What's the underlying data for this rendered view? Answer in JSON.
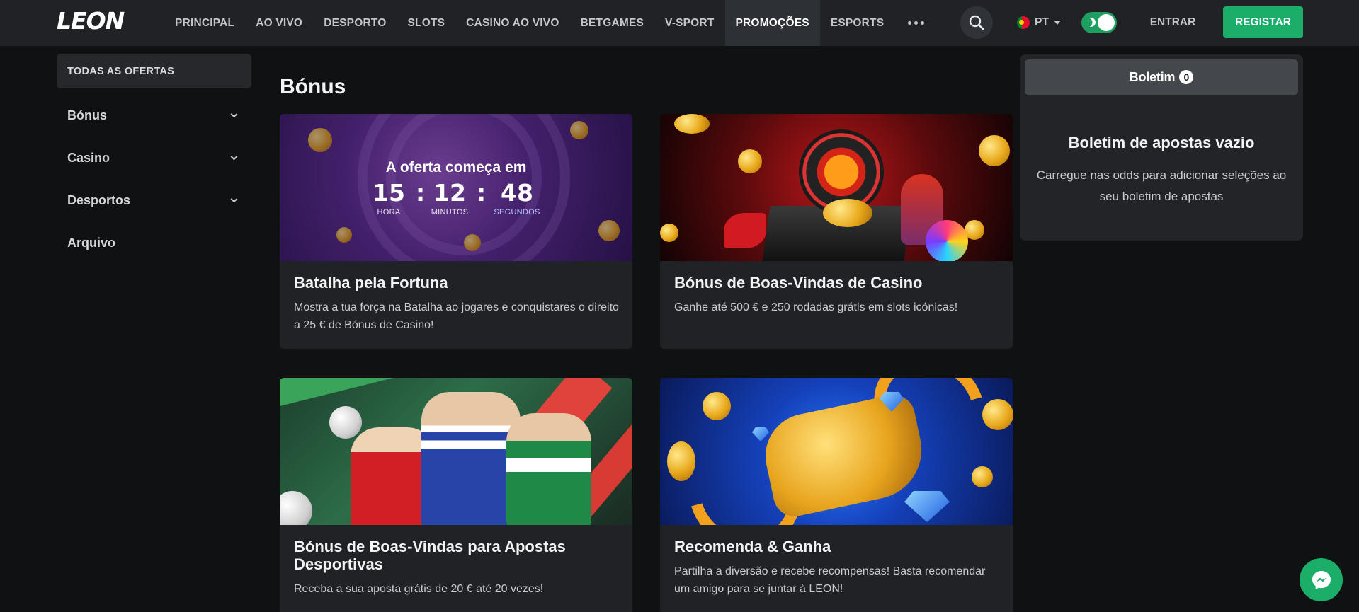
{
  "header": {
    "logo": "LEON",
    "nav": [
      {
        "label": "PRINCIPAL"
      },
      {
        "label": "AO VIVO"
      },
      {
        "label": "DESPORTO"
      },
      {
        "label": "SLOTS"
      },
      {
        "label": "CASINO AO VIVO"
      },
      {
        "label": "BETGAMES"
      },
      {
        "label": "V-SPORT"
      },
      {
        "label": "PROMOÇÕES",
        "active": true
      },
      {
        "label": "ESPORTS"
      }
    ],
    "language": "PT",
    "login_label": "ENTRAR",
    "register_label": "REGISTAR"
  },
  "sidebar": {
    "all_offers": "TODAS AS OFERTAS",
    "items": [
      {
        "label": "Bónus",
        "expandable": true
      },
      {
        "label": "Casino",
        "expandable": true
      },
      {
        "label": "Desportos",
        "expandable": true
      },
      {
        "label": "Arquivo",
        "expandable": false
      }
    ]
  },
  "main": {
    "title": "Bónus",
    "cards": [
      {
        "title": "Batalha pela Fortuna",
        "description": "Mostra a tua força na Batalha ao jogares e conquistares o direito a 25 € de Bónus de Casino!",
        "timer": {
          "label": "A oferta começa em",
          "hours": "15",
          "minutes": "12",
          "seconds": "48",
          "hours_label": "HORA",
          "minutes_label": "MINUTOS",
          "seconds_label": "SEGUNDOS"
        }
      },
      {
        "title": "Bónus de Boas-Vindas de Casino",
        "description": "Ganhe até 500 € e 250 rodadas grátis em slots icónicas!"
      },
      {
        "title": "Bónus de Boas-Vindas para Apostas Desportivas",
        "description": "Receba a sua aposta grátis de 20 € até 20 vezes!"
      },
      {
        "title": "Recomenda & Ganha",
        "description": "Partilha a diversão e recebe recompensas! Basta recomendar um amigo para se juntar à LEON!"
      }
    ]
  },
  "betslip": {
    "tab_label": "Boletim",
    "count": "0",
    "empty_title": "Boletim de apostas vazio",
    "empty_description": "Carregue nas odds para adicionar seleções ao seu boletim de apostas"
  },
  "colors": {
    "accent": "#1bae68",
    "header_bg": "#202225",
    "page_bg": "#101113",
    "card_bg": "#202226"
  },
  "icons": {
    "search": "search-icon",
    "more": "more-dots-icon",
    "theme": "moon-icon",
    "chat": "messenger-icon",
    "chevron": "chevron-down-icon"
  }
}
